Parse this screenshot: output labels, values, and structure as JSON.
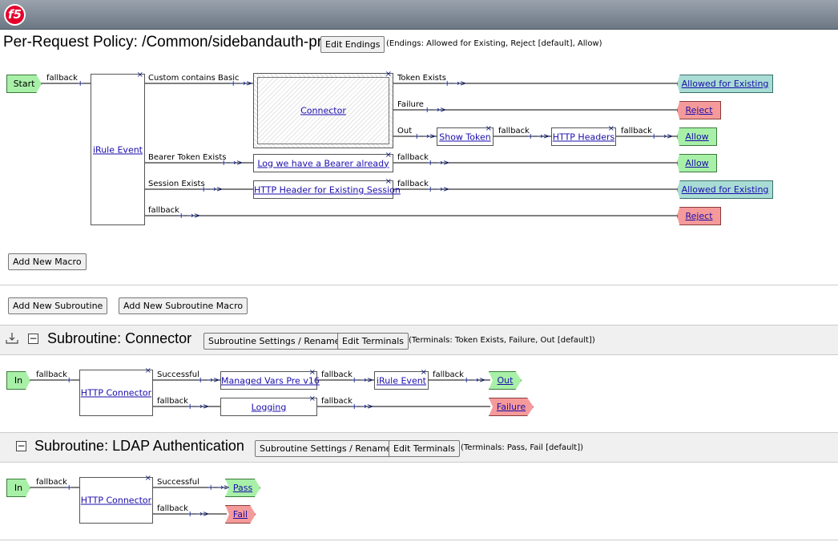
{
  "header": {
    "logo": "f5"
  },
  "policy": {
    "title": "Per-Request Policy: /Common/sidebandauth-prp",
    "edit_endings": "Edit Endings",
    "endings_note": "(Endings: Allowed for Existing, Reject [default], Allow)"
  },
  "main_flow": {
    "start": "Start",
    "fallback": "fallback",
    "irule_event": "iRule Event",
    "branches": {
      "custom_basic": "Custom contains Basic",
      "bearer_exists": "Bearer Token Exists",
      "session_exists": "Session Exists",
      "fallback": "fallback"
    },
    "connector": "Connector",
    "connector_out": {
      "token_exists": "Token Exists",
      "failure": "Failure",
      "out": "Out"
    },
    "show_token": "Show Token",
    "http_headers": "HTTP Headers",
    "log_bearer": "Log we have a Bearer already",
    "http_header_session": "HTTP Header for Existing Session",
    "endings": {
      "allowed_existing_1": "Allowed for Existing",
      "reject_1": "Reject",
      "allow_1": "Allow",
      "allow_2": "Allow",
      "allowed_existing_2": "Allowed for Existing",
      "reject_2": "Reject"
    }
  },
  "buttons": {
    "add_macro": "Add New Macro",
    "add_subroutine": "Add New Subroutine",
    "add_subroutine_macro": "Add New Subroutine Macro"
  },
  "sub_connector": {
    "title": "Subroutine: Connector",
    "settings": "Subroutine Settings / Rename",
    "edit_terminals": "Edit Terminals",
    "terminals_note": "(Terminals: Token Exists, Failure, Out [default])",
    "in": "In",
    "fallback": "fallback",
    "http_connector": "HTTP Connector",
    "successful": "Successful",
    "managed_vars": "Managed Vars Pre v16",
    "irule_event": "iRule Event",
    "logging": "Logging",
    "out": "Out",
    "failure": "Failure"
  },
  "sub_ldap": {
    "title": "Subroutine: LDAP Authentication",
    "settings": "Subroutine Settings / Rename",
    "edit_terminals": "Edit Terminals",
    "terminals_note": "(Terminals: Pass, Fail [default])",
    "in": "In",
    "fallback": "fallback",
    "http_connector": "HTTP Connector",
    "successful": "Successful",
    "pass": "Pass",
    "fail": "Fail"
  },
  "colors": {
    "green": "#a8f0a8",
    "teal": "#a8dcd4",
    "red": "#f59a9a",
    "link": "#1a0dab",
    "topbar": "#7c8692"
  },
  "icons": [
    "f5-logo",
    "delete-x-icon",
    "add-plus-icon",
    "arrow-icon",
    "collapse-minus-icon",
    "drag-handle-icon"
  ]
}
